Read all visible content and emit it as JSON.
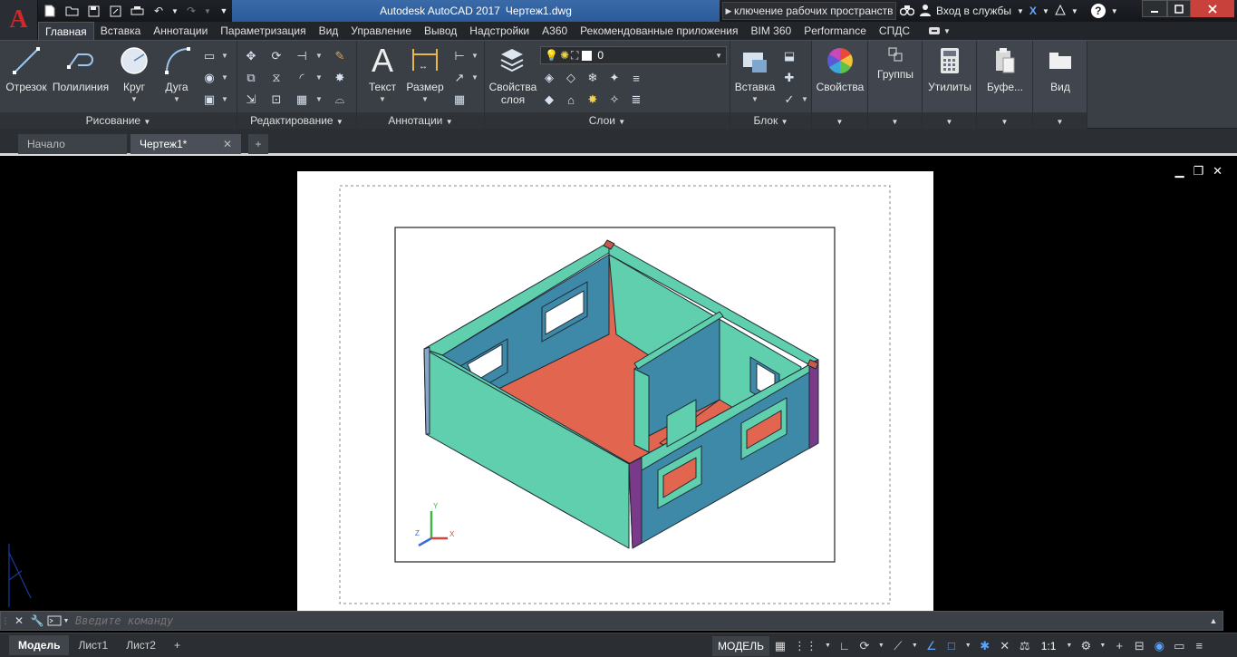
{
  "titlebar": {
    "app_logo": "A",
    "title_app": "Autodesk AutoCAD 2017",
    "title_file": "Чертеж1.dwg",
    "workspace": "ключение рабочих пространств",
    "signin": "Вход в службы",
    "help": "?"
  },
  "ribbon_tabs": [
    "Главная",
    "Вставка",
    "Аннотации",
    "Параметризация",
    "Вид",
    "Управление",
    "Вывод",
    "Надстройки",
    "A360",
    "Рекомендованные приложения",
    "BIM 360",
    "Performance",
    "СПДС"
  ],
  "ribbon": {
    "draw": {
      "title": "Рисование",
      "line": "Отрезок",
      "polyline": "Полилиния",
      "circle": "Круг",
      "arc": "Дуга"
    },
    "modify": {
      "title": "Редактирование"
    },
    "annotation": {
      "title": "Аннотации",
      "text": "Текст",
      "dimension": "Размер"
    },
    "layers": {
      "title": "Слои",
      "properties_line1": "Свойства",
      "properties_line2": "слоя",
      "current_layer": "0"
    },
    "block": {
      "title": "Блок",
      "insert": "Вставка"
    },
    "properties": {
      "label": "Свойства"
    },
    "groups": {
      "label": "Группы"
    },
    "utilities": {
      "label": "Утилиты"
    },
    "clipboard": {
      "label": "Буфе..."
    },
    "view": {
      "label": "Вид"
    }
  },
  "file_tabs": {
    "start": "Начало",
    "drawing": "Чертеж1*"
  },
  "cmdline": {
    "placeholder": "Введите команду"
  },
  "layout_tabs": {
    "model": "Модель",
    "sheet1": "Лист1",
    "sheet2": "Лист2"
  },
  "status": {
    "model": "МОДЕЛЬ",
    "scale": "1:1"
  },
  "colors": {
    "wall_teal": "#5fcfae",
    "wall_blue": "#3e88a8",
    "floor": "#e2654f",
    "title_blue": "#2b5a98"
  }
}
